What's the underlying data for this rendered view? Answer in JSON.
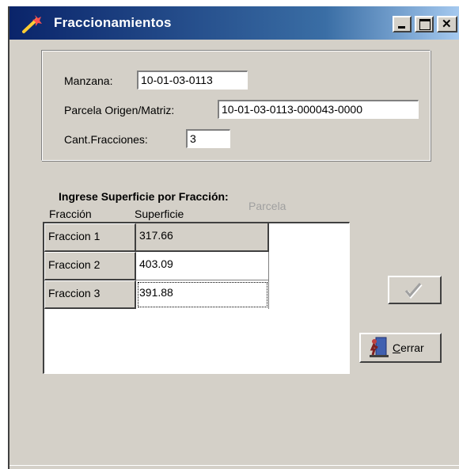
{
  "window": {
    "title": "Fraccionamientos"
  },
  "form": {
    "manzana_label": "Manzana:",
    "manzana_value": "10-01-03-0113",
    "parcela_label": "Parcela Origen/Matriz:",
    "parcela_value": "10-01-03-0113-000043-0000",
    "cant_label": "Cant.Fracciones:",
    "cant_value": "3"
  },
  "grid": {
    "title": "Ingrese Superficie por Fracción:",
    "headers": [
      "Fracción",
      "Superficie",
      "Parcela"
    ],
    "rows": [
      {
        "fraccion": "Fraccion 1",
        "superficie": "317.66"
      },
      {
        "fraccion": "Fraccion 2",
        "superficie": "403.09"
      },
      {
        "fraccion": "Fraccion 3",
        "superficie": "391.88"
      }
    ]
  },
  "buttons": {
    "confirm_icon": "checkmark-icon",
    "close_icon": "exit-door-icon",
    "close_label_underlined": "C",
    "close_label_rest": "errar"
  },
  "colors": {
    "title_bar": "#0a246a",
    "dialog_face": "#d4d0c8"
  }
}
